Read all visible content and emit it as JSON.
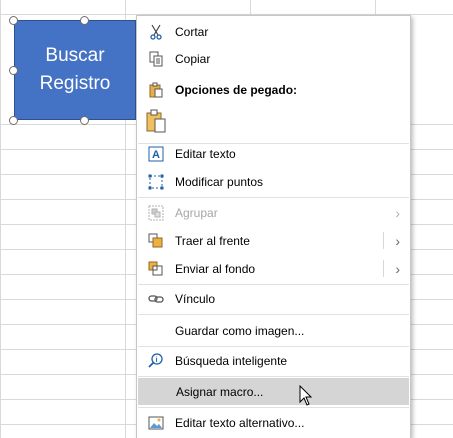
{
  "shape": {
    "line1": "Buscar",
    "line2": "Registro",
    "fill": "#4472c4"
  },
  "menu": {
    "items": [
      {
        "label": "Cortar",
        "icon": "scissors-icon"
      },
      {
        "label": "Copiar",
        "icon": "copy-icon"
      },
      {
        "label": "Opciones de pegado:",
        "icon": "paste-icon"
      },
      {
        "label": "",
        "icon": "paste-option-icon"
      },
      {
        "label": "Editar texto",
        "icon": "edit-text-icon"
      },
      {
        "label": "Modificar puntos",
        "icon": "edit-points-icon"
      },
      {
        "label": "Agrupar",
        "icon": "group-icon",
        "disabled": true
      },
      {
        "label": "Traer al frente",
        "icon": "bring-to-front-icon"
      },
      {
        "label": "Enviar al fondo",
        "icon": "send-to-back-icon"
      },
      {
        "label": "Vínculo",
        "icon": "link-icon"
      },
      {
        "label": "Guardar como imagen...",
        "icon": ""
      },
      {
        "label": "Búsqueda inteligente",
        "icon": "smart-lookup-icon"
      },
      {
        "label": "Asignar macro...",
        "icon": "",
        "hover": true
      },
      {
        "label": "Editar texto alternativo...",
        "icon": "alt-text-icon"
      }
    ]
  }
}
